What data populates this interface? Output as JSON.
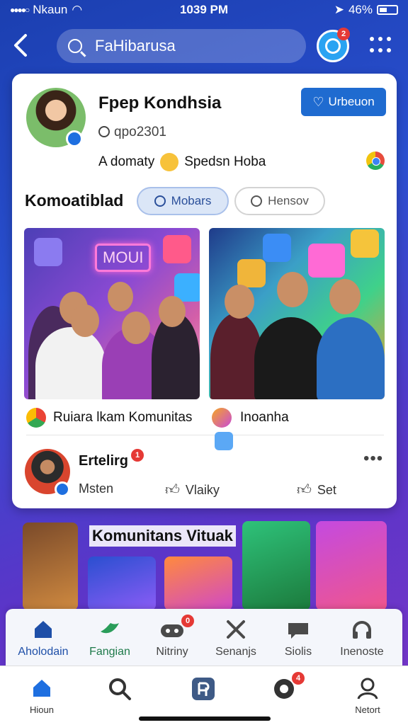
{
  "status_bar": {
    "carrier": "Nkaun",
    "time": "1039 PM",
    "battery": "46%"
  },
  "top_bar": {
    "search_value": "FaHibarusa",
    "notification_count": "2"
  },
  "profile": {
    "name": "Fpep Kondhsia",
    "handle": "qpo2301",
    "meta_left": "A domaty",
    "meta_right": "Spedsn Hoba",
    "follow_label": "Urbeuon"
  },
  "section": {
    "title": "Komoatiblad",
    "chip_active": "Mobars",
    "chip_inactive": "Hensov"
  },
  "posts": [
    {
      "neon": "MOUI",
      "caption": "Ruiara lkam Komunitas"
    },
    {
      "caption": "Inoanha"
    }
  ],
  "comment": {
    "name": "Ertelirg",
    "badge": "1",
    "actions": [
      "Msten",
      "Vlaiky",
      "Set"
    ]
  },
  "feed_strip": {
    "title": "Komunitans Vituak"
  },
  "tabs": [
    {
      "label": "Aholodain",
      "icon": "home-icon"
    },
    {
      "label": "Fangian",
      "icon": "bird-icon"
    },
    {
      "label": "Nitriny",
      "icon": "gamepad-icon",
      "badge": "0"
    },
    {
      "label": "Senanjs",
      "icon": "share-icon"
    },
    {
      "label": "Siolis",
      "icon": "chat-bubble-icon"
    },
    {
      "label": "Inenoste",
      "icon": "headphone-icon"
    }
  ],
  "bottom_nav": [
    {
      "label": "Hioun",
      "icon": "home-icon"
    },
    {
      "label": "",
      "icon": "search-icon"
    },
    {
      "label": "",
      "icon": "app-icon"
    },
    {
      "label": "",
      "icon": "messenger-icon",
      "badge": "4"
    },
    {
      "label": "Netort",
      "icon": "profile-icon"
    }
  ],
  "colors": {
    "accent": "#1f6bd0",
    "badge": "#e53935",
    "tab_active": "#1e4fa8"
  }
}
